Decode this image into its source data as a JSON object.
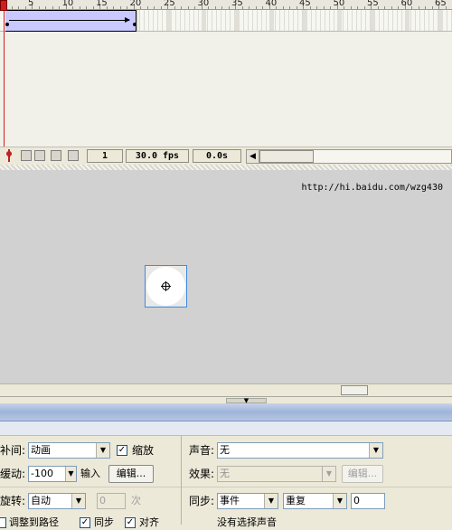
{
  "timeline": {
    "ruler_numbers": [
      "5",
      "10",
      "15",
      "20",
      "25",
      "30",
      "35",
      "40",
      "45",
      "50",
      "55",
      "60",
      "65"
    ],
    "current_frame": "1",
    "frame_rate": "30.0 fps",
    "elapsed_time": "0.0s"
  },
  "stage": {
    "watermark": "http://hi.baidu.com/wzg430"
  },
  "properties": {
    "tween_label": "补间:",
    "tween_value": "动画",
    "scale_label": "缩放",
    "scale_checked": true,
    "ease_label": "缓动:",
    "ease_value": "-100",
    "ease_input_label": "输入",
    "edit_button": "编辑...",
    "rotate_label": "旋转:",
    "rotate_value": "自动",
    "rotate_count": "0",
    "times_label": "次",
    "orient_label": "调整到路径",
    "sync_check_label": "同步",
    "sync_checked": true,
    "snap_label": "对齐",
    "snap_checked": true,
    "sound_label": "声音:",
    "sound_value": "无",
    "effect_label": "效果:",
    "effect_value": "无",
    "effect_edit_button": "编辑...",
    "sync_label": "同步:",
    "sync_value": "事件",
    "repeat_value": "重复",
    "repeat_count": "0",
    "no_sound_text": "没有选择声音"
  }
}
